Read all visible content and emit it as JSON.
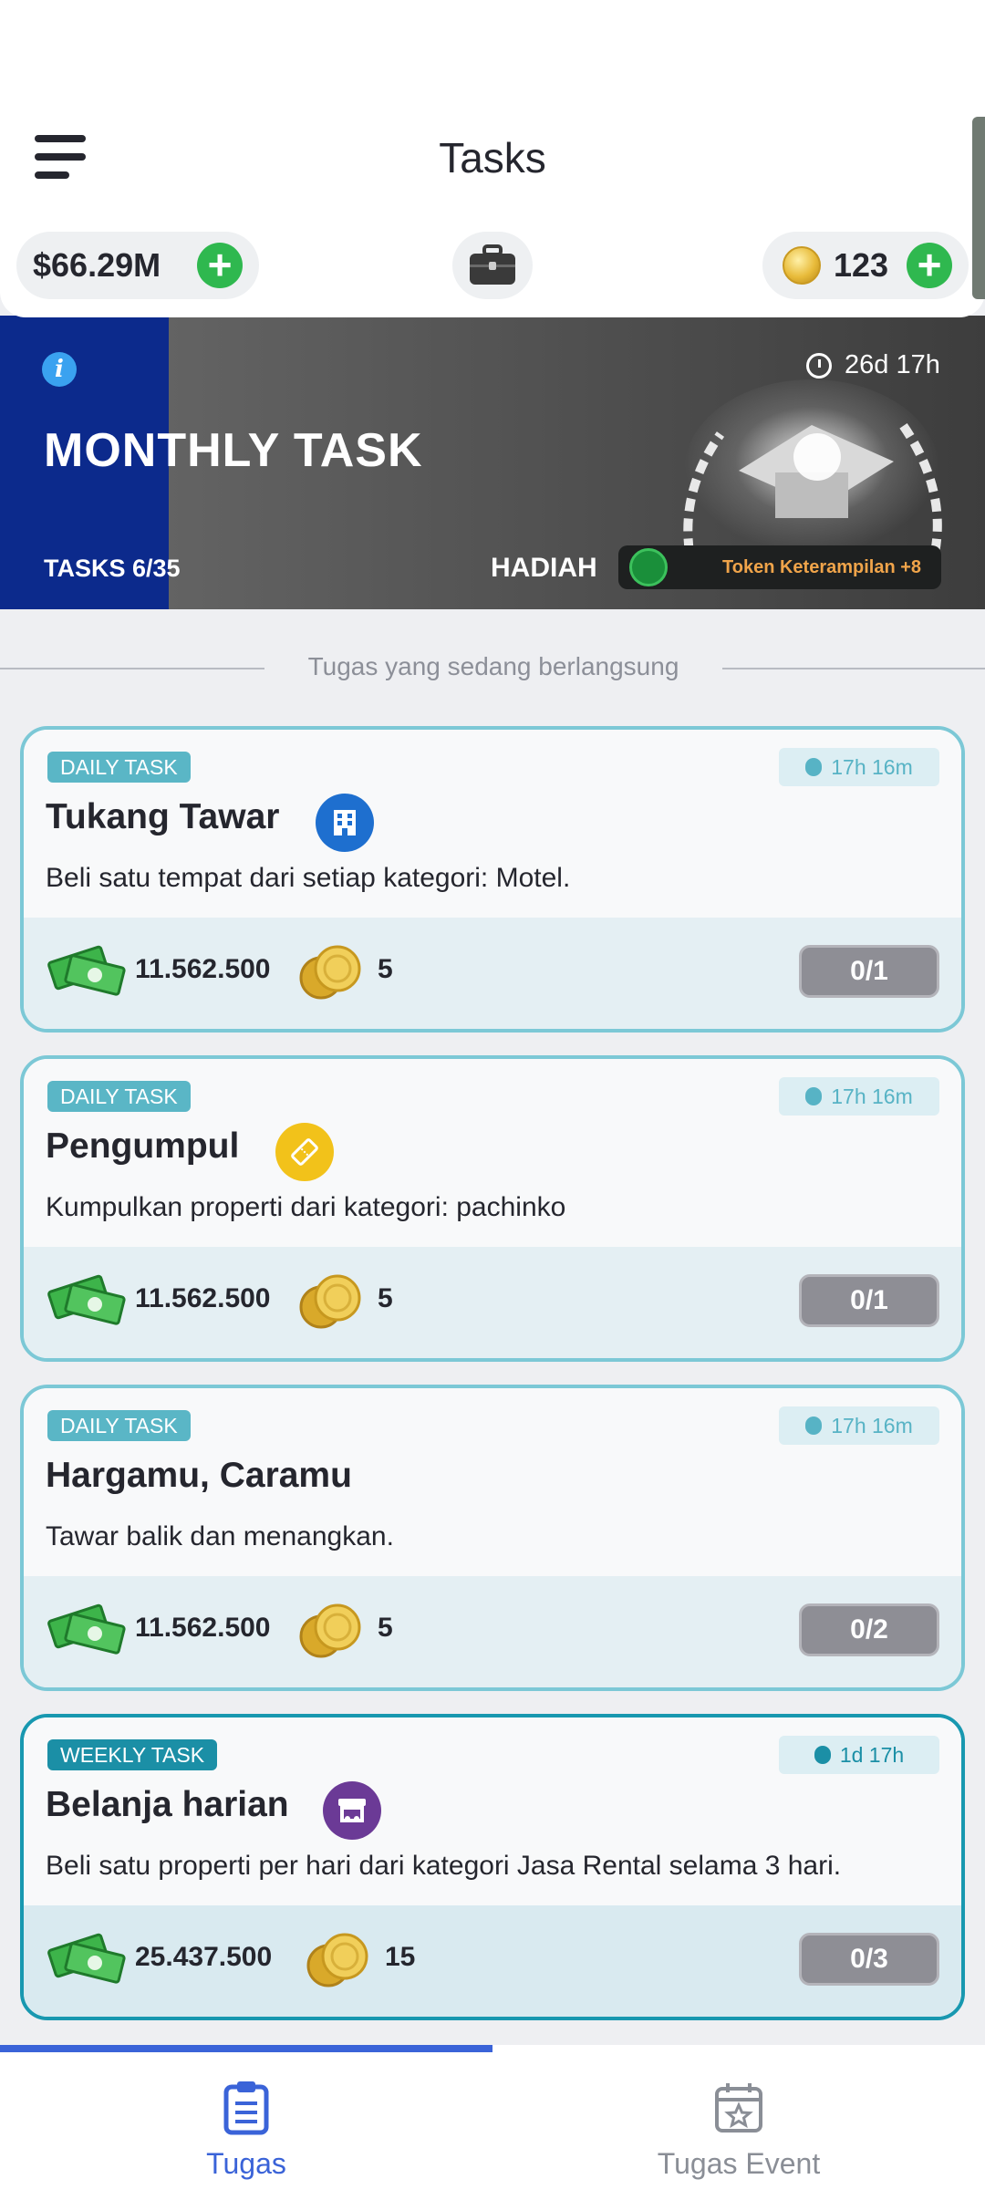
{
  "header": {
    "title": "Tasks",
    "money": "$66.29M",
    "coins": "123"
  },
  "banner": {
    "title": "MONTHLY TASK",
    "tasks_progress": "TASKS 6/35",
    "tasks_completed": 6,
    "tasks_total": 35,
    "timer": "26d 17h",
    "reward_label": "HADIAH",
    "reward_item": "Token Keterampilan +8"
  },
  "section": {
    "ongoing_label": "Tugas yang sedang berlangsung"
  },
  "tasks": [
    {
      "type": "DAILY TASK",
      "timer": "17h 16m",
      "title": "Tukang Tawar",
      "icon": "building-icon",
      "icon_color": "#1e6fcf",
      "description": "Beli satu tempat dari setiap kategori: Motel.",
      "cash_reward": "11.562.500",
      "coin_reward": "5",
      "progress": "0/1"
    },
    {
      "type": "DAILY TASK",
      "timer": "17h 16m",
      "title": "Pengumpul",
      "icon": "ticket-icon",
      "icon_color": "#f2c21a",
      "description": "Kumpulkan properti dari kategori: pachinko",
      "cash_reward": "11.562.500",
      "coin_reward": "5",
      "progress": "0/1"
    },
    {
      "type": "DAILY TASK",
      "timer": "17h 16m",
      "title": "Hargamu, Caramu",
      "description": "Tawar balik dan menangkan.",
      "cash_reward": "11.562.500",
      "coin_reward": "5",
      "progress": "0/2"
    },
    {
      "type": "WEEKLY TASK",
      "timer": "1d 17h",
      "title": "Belanja harian",
      "icon": "rental-shop-icon",
      "icon_color": "#6b3a96",
      "description": "Beli satu properti per hari dari kategori Jasa Rental selama 3 hari.",
      "cash_reward": "25.437.500",
      "coin_reward": "15",
      "progress": "0/3"
    }
  ],
  "nav": {
    "tab1": "Tugas",
    "tab2": "Tugas Event"
  },
  "colors": {
    "accent": "#3a63d8",
    "daily_border": "#7cc8d6",
    "weekly_border": "#1898b0",
    "banner_progress": "#0c2a8c",
    "reward_text": "#f0a44a"
  }
}
